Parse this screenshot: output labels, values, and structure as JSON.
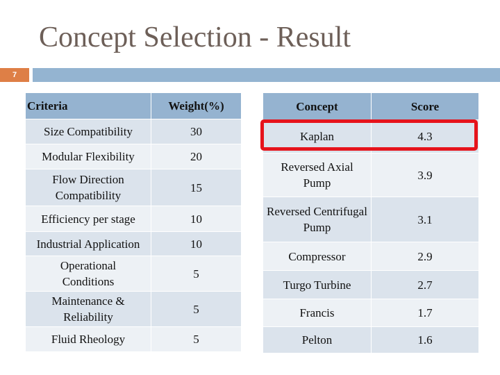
{
  "slide": {
    "title": "Concept Selection - Result",
    "number": "7",
    "accent_colors": {
      "number_badge": "#de7f46",
      "header_bar": "#94b4d1",
      "highlight": "#e6131b"
    }
  },
  "criteria_table": {
    "headers": [
      "Criteria",
      "Weight(%)"
    ],
    "rows": [
      {
        "criteria": "Size Compatibility",
        "weight": "30"
      },
      {
        "criteria": "Modular Flexibility",
        "weight": "20"
      },
      {
        "criteria": "Flow Direction Compatibility",
        "weight": "15"
      },
      {
        "criteria": "Efficiency per stage",
        "weight": "10"
      },
      {
        "criteria": "Industrial Application",
        "weight": "10"
      },
      {
        "criteria": "Operational Conditions",
        "weight": "5"
      },
      {
        "criteria": "Maintenance & Reliability",
        "weight": "5"
      },
      {
        "criteria": "Fluid Rheology",
        "weight": "5"
      }
    ]
  },
  "concept_table": {
    "headers": [
      "Concept",
      "Score"
    ],
    "highlighted_row": "Kaplan",
    "rows": [
      {
        "concept": "Kaplan",
        "score": "4.3"
      },
      {
        "concept": "Reversed Axial Pump",
        "score": "3.9"
      },
      {
        "concept": "Reversed Centrifugal  Pump",
        "score": "3.1"
      },
      {
        "concept": "Compressor",
        "score": "2.9"
      },
      {
        "concept": "Turgo Turbine",
        "score": "2.7"
      },
      {
        "concept": "Francis",
        "score": "1.7"
      },
      {
        "concept": "Pelton",
        "score": "1.6"
      }
    ]
  }
}
